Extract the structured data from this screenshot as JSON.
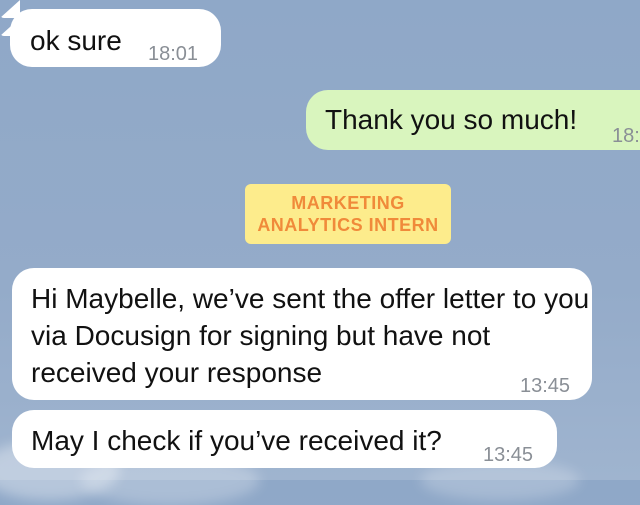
{
  "messages": [
    {
      "direction": "incoming",
      "text": "ok sure",
      "time": "18:01"
    },
    {
      "direction": "outgoing",
      "text": "Thank you so much!",
      "time": "18:"
    },
    {
      "direction": "incoming",
      "text": "Hi Maybelle, we’ve sent the offer letter to you via Docusign for signing but have not received your response",
      "time": "13:45"
    },
    {
      "direction": "incoming",
      "text": "May I check if you’ve received it?",
      "time": "13:45"
    }
  ],
  "tag": {
    "line1": "MARKETING",
    "line2": "ANALYTICS INTERN"
  },
  "colors": {
    "incoming": "#ffffff",
    "outgoing": "#d9f5be",
    "tag_bg": "#fdec8c",
    "tag_text": "#f08a3a",
    "background": "#8fa8c8"
  }
}
